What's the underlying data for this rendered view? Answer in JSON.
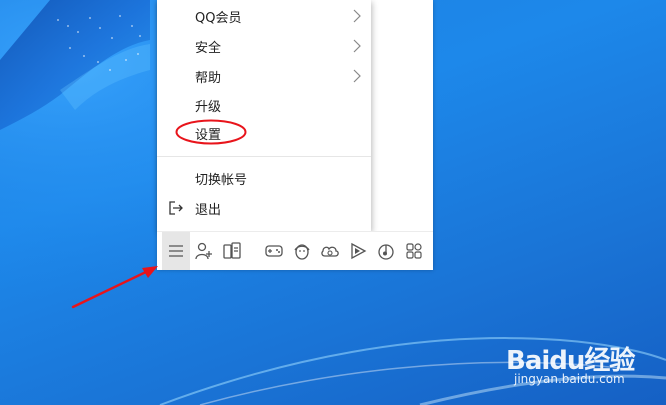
{
  "menu": {
    "items": [
      {
        "label": "QQ会员",
        "submenu": true
      },
      {
        "label": "安全",
        "submenu": true
      },
      {
        "label": "帮助",
        "submenu": true
      },
      {
        "label": "升级",
        "submenu": false
      },
      {
        "label": "设置",
        "submenu": false,
        "highlighted": true
      },
      {
        "label": "切换帐号",
        "submenu": false
      },
      {
        "label": "退出",
        "submenu": false,
        "icon": "logout-icon"
      }
    ]
  },
  "toolbar": {
    "buttons": [
      {
        "name": "main-menu",
        "icon": "hamburger-icon",
        "active": true
      },
      {
        "name": "add-friend",
        "icon": "add-contact-icon"
      },
      {
        "name": "app-manager",
        "icon": "app-manager-icon"
      },
      {
        "name": "game",
        "icon": "gamepad-icon"
      },
      {
        "name": "pet",
        "icon": "penguin-icon"
      },
      {
        "name": "weiyun",
        "icon": "cloud-icon"
      },
      {
        "name": "video",
        "icon": "play-icon"
      },
      {
        "name": "music",
        "icon": "music-icon"
      },
      {
        "name": "app-center",
        "icon": "apps-grid-icon"
      }
    ]
  },
  "annotation": {
    "color": "#e8141b"
  },
  "watermark": {
    "top": "Baidu经验",
    "bottom": "jingyan.baidu.com"
  }
}
